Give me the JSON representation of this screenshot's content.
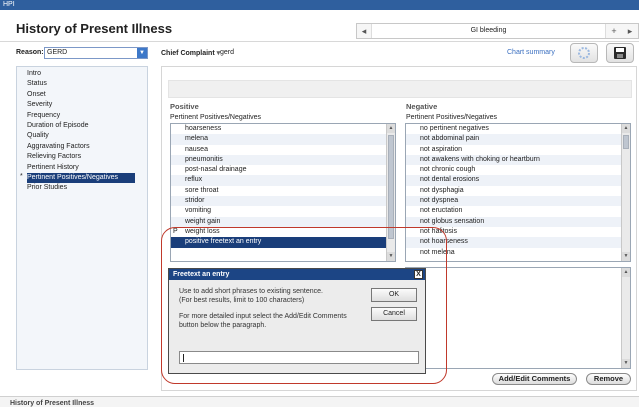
{
  "window": {
    "title": "HPI"
  },
  "header": {
    "title": "History of Present Illness",
    "nav": {
      "prev_label": "◂",
      "center_label": "GI bleeding",
      "add_label": "+",
      "next_label": "▸"
    }
  },
  "reason": {
    "label": "Reason:",
    "value": "GERD"
  },
  "chief_complaint": {
    "label": "Chief Complaint",
    "value": "gerd"
  },
  "chart_summary_label": "Chart summary",
  "toolbar": {
    "refresh_icon": "refresh-icon",
    "save_icon": "save-icon"
  },
  "sidebar": {
    "items": [
      {
        "label": "Intro"
      },
      {
        "label": "Status"
      },
      {
        "label": "Onset"
      },
      {
        "label": "Severity"
      },
      {
        "label": "Frequency"
      },
      {
        "label": "Duration of Episode"
      },
      {
        "label": "Quality"
      },
      {
        "label": "Aggravating Factors"
      },
      {
        "label": "Relieving Factors"
      },
      {
        "label": "Pertinent History"
      },
      {
        "label": "Pertinent Positives/Negatives",
        "marker": "*"
      },
      {
        "label": "Prior Studies"
      }
    ]
  },
  "positive": {
    "title": "Positive",
    "column_header": "Pertinent Positives/Negatives",
    "items": [
      {
        "label": "hoarseness",
        "flag": ""
      },
      {
        "label": "melena",
        "flag": ""
      },
      {
        "label": "nausea",
        "flag": ""
      },
      {
        "label": "pneumonitis",
        "flag": ""
      },
      {
        "label": "post-nasal drainage",
        "flag": ""
      },
      {
        "label": "reflux",
        "flag": ""
      },
      {
        "label": "sore throat",
        "flag": ""
      },
      {
        "label": "stridor",
        "flag": ""
      },
      {
        "label": "vomiting",
        "flag": ""
      },
      {
        "label": "weight gain",
        "flag": ""
      },
      {
        "label": "weight loss",
        "flag": "P"
      },
      {
        "label": "positive freetext an entry",
        "flag": ""
      }
    ]
  },
  "negative": {
    "title": "Negative",
    "column_header": "Pertinent Positives/Negatives",
    "items": [
      {
        "label": "no pertinent negatives"
      },
      {
        "label": "not abdominal pain"
      },
      {
        "label": "not aspiration"
      },
      {
        "label": "not awakens with choking or heartburn"
      },
      {
        "label": "not chronic cough"
      },
      {
        "label": "not dental erosions"
      },
      {
        "label": "not dysphagia"
      },
      {
        "label": "not dyspnea"
      },
      {
        "label": "not eructation"
      },
      {
        "label": "not globus sensation"
      },
      {
        "label": "not halitosis"
      },
      {
        "label": "not hoarseness"
      },
      {
        "label": "not melena"
      }
    ]
  },
  "buttons": {
    "add_edit_comments": "Add/Edit Comments",
    "remove": "Remove"
  },
  "dialog": {
    "title": "Freetext an entry",
    "close_label": "X",
    "line1": "Use to add short phrases to existing sentence.",
    "line2": "(For best results, limit to 100 characters)",
    "line3": "For more detailed input select the Add/Edit Comments",
    "line4": "button below the paragraph.",
    "ok_label": "OK",
    "cancel_label": "Cancel",
    "input_value": ""
  },
  "bottom": {
    "title": "History of Present Illness"
  }
}
